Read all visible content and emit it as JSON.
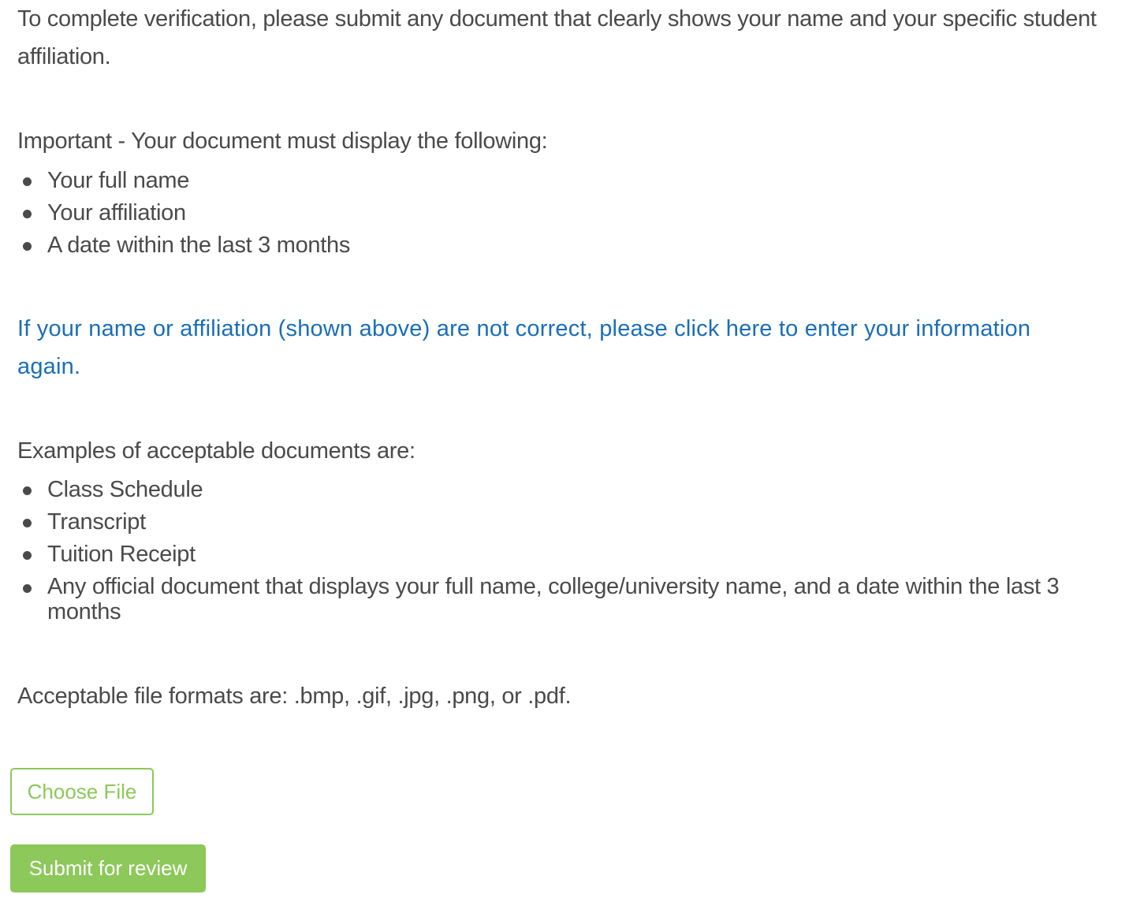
{
  "intro": "To complete verification, please submit any document that clearly shows your name and your specific student affiliation.",
  "requirements": {
    "heading": "Important - Your document must display the following:",
    "items": [
      "Your full name",
      "Your affiliation",
      "A date within the last 3 months"
    ]
  },
  "correction_link": "If your name or affiliation (shown above) are not correct, please click here to enter your information again.",
  "examples": {
    "heading": "Examples of acceptable documents are:",
    "items": [
      "Class Schedule",
      "Transcript",
      "Tuition Receipt",
      "Any official document that displays your full name, college/university name, and a date within the last 3 months"
    ]
  },
  "formats": "Acceptable file formats are: .bmp, .gif, .jpg, .png, or .pdf.",
  "buttons": {
    "choose_file": "Choose File",
    "submit": "Submit for review"
  },
  "colors": {
    "text": "#4a4a4a",
    "link": "#1a6eb8",
    "accent_green": "#8cc85a"
  }
}
